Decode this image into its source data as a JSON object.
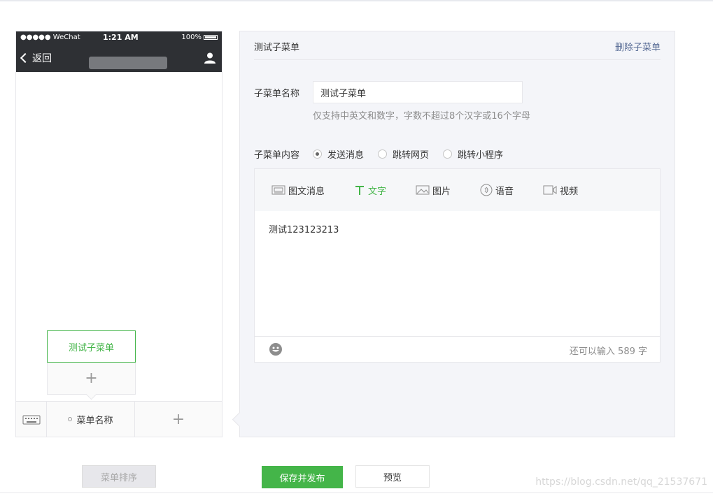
{
  "phone": {
    "carrier": "●●●●● WeChat",
    "time": "1:21 AM",
    "battery": "100%",
    "back_label": "返回",
    "submenu_item": "测试子菜单",
    "submenu_add": "+",
    "menu_item": "菜单名称",
    "menu_add": "+"
  },
  "editor": {
    "title": "测试子菜单",
    "delete_label": "删除子菜单",
    "name_label": "子菜单名称",
    "name_value": "测试子菜单",
    "name_hint": "仅支持中英文和数字，字数不超过8个汉字或16个字母",
    "content_label": "子菜单内容",
    "options": [
      "发送消息",
      "跳转网页",
      "跳转小程序"
    ],
    "selected_option": "发送消息",
    "tabs": [
      "图文消息",
      "文字",
      "图片",
      "语音",
      "视频"
    ],
    "active_tab": "文字",
    "text_content": "测试123123213",
    "remaining": "还可以输入 589 字"
  },
  "buttons": {
    "sort": "菜单排序",
    "save": "保存并发布",
    "preview": "预览"
  },
  "watermark": "https://blog.csdn.net/qq_21537671",
  "colors": {
    "accent": "#44b549",
    "link": "#576b95",
    "statusbar": "#2e3034"
  }
}
